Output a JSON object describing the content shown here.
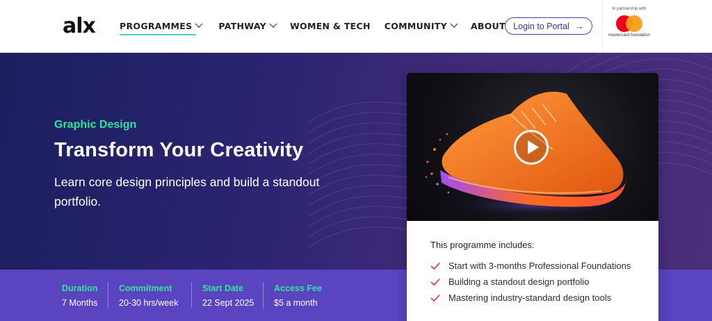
{
  "header": {
    "logo": "alx",
    "nav": [
      {
        "label": "PROGRAMMES",
        "has_dropdown": true,
        "active": true
      },
      {
        "label": "PATHWAY",
        "has_dropdown": true
      },
      {
        "label": "WOMEN & TECH",
        "has_dropdown": false
      },
      {
        "label": "COMMUNITY",
        "has_dropdown": true
      },
      {
        "label": "ABOUT ALX",
        "has_dropdown": true
      }
    ],
    "login_label": "Login to Portal",
    "partner_label": "In partnership with",
    "partner_name": "mastercard foundation"
  },
  "hero": {
    "category": "Graphic Design",
    "title": "Transform Your Creativity",
    "subtitle": "Learn core design principles and build a standout portfolio."
  },
  "stats": [
    {
      "label": "Duration",
      "value": "7 Months"
    },
    {
      "label": "Commitment",
      "value": "20-30 hrs/week"
    },
    {
      "label": "Start Date",
      "value": "22 Sept 2025"
    },
    {
      "label": "Access Fee",
      "value": "$5 a month"
    }
  ],
  "card": {
    "includes_title": "This programme includes:",
    "items": [
      "Start with 3-months Professional Foundations",
      "Building a standout design portfolio",
      "Mastering industry-standard design tools"
    ]
  },
  "colors": {
    "accent_green": "#2ee59d",
    "brand_purple": "#4b3fb8",
    "check_red": "#e5484d",
    "stats_bg": "#5a44c0"
  }
}
